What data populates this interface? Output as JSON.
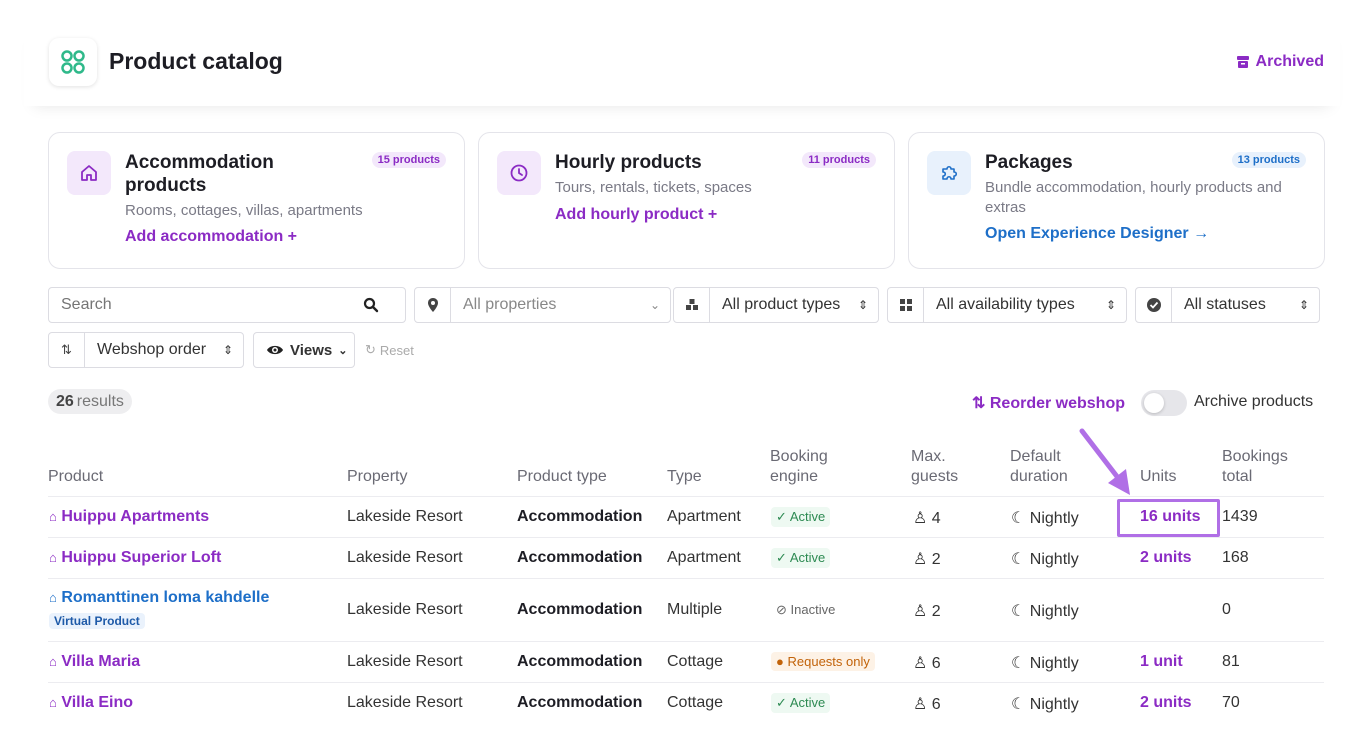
{
  "header": {
    "title": "Product catalog",
    "archived_label": "Archived"
  },
  "cards": [
    {
      "title": "Accommodation products",
      "badge": "15 products",
      "description": "Rooms, cottages, villas, apartments",
      "cta": "Add accommodation +"
    },
    {
      "title": "Hourly products",
      "badge": "11 products",
      "description": "Tours, rentals, tickets, spaces",
      "cta": "Add hourly product +"
    },
    {
      "title": "Packages",
      "badge": "13 products",
      "description": "Bundle accommodation, hourly products and extras",
      "cta": "Open Experience Designer →"
    }
  ],
  "filters": {
    "search_placeholder": "Search",
    "properties": "All properties",
    "product_types": "All product types",
    "availability_types": "All availability types",
    "statuses": "All statuses",
    "sort": "Webshop order",
    "views": "Views",
    "reset": "Reset"
  },
  "results": {
    "count": "26",
    "label": "results"
  },
  "actions": {
    "reorder": "Reorder webshop",
    "archive_products": "Archive products"
  },
  "table": {
    "headers": {
      "product": "Product",
      "property": "Property",
      "product_type": "Product type",
      "type": "Type",
      "booking_engine_1": "Booking",
      "booking_engine_2": "engine",
      "max_guests_1": "Max.",
      "max_guests_2": "guests",
      "default_duration_1": "Default",
      "default_duration_2": "duration",
      "units": "Units",
      "bookings_total_1": "Bookings",
      "bookings_total_2": "total"
    },
    "rows": [
      {
        "product": "Huippu Apartments",
        "property": "Lakeside Resort",
        "product_type": "Accommodation",
        "type": "Apartment",
        "booking_engine": "Active",
        "max_guests": "4",
        "duration": "Nightly",
        "units": "16 units",
        "bookings": "1439"
      },
      {
        "product": "Huippu Superior Loft",
        "property": "Lakeside Resort",
        "product_type": "Accommodation",
        "type": "Apartment",
        "booking_engine": "Active",
        "max_guests": "2",
        "duration": "Nightly",
        "units": "2 units",
        "bookings": "168"
      },
      {
        "product": "Romanttinen loma kahdelle",
        "badge": "Virtual Product",
        "property": "Lakeside Resort",
        "product_type": "Accommodation",
        "type": "Multiple",
        "booking_engine": "Inactive",
        "max_guests": "2",
        "duration": "Nightly",
        "units": "",
        "bookings": "0"
      },
      {
        "product": "Villa Maria",
        "property": "Lakeside Resort",
        "product_type": "Accommodation",
        "type": "Cottage",
        "booking_engine": "Requests only",
        "max_guests": "6",
        "duration": "Nightly",
        "units": "1 unit",
        "bookings": "81"
      },
      {
        "product": "Villa Eino",
        "property": "Lakeside Resort",
        "product_type": "Accommodation",
        "type": "Cottage",
        "booking_engine": "Active",
        "max_guests": "6",
        "duration": "Nightly",
        "units": "2 units",
        "bookings": "70"
      }
    ]
  },
  "colors": {
    "accent": "#8b2bc4",
    "logo": "#2fb98a",
    "link_blue": "#1e6fc8",
    "highlight": "#b06fe6"
  }
}
